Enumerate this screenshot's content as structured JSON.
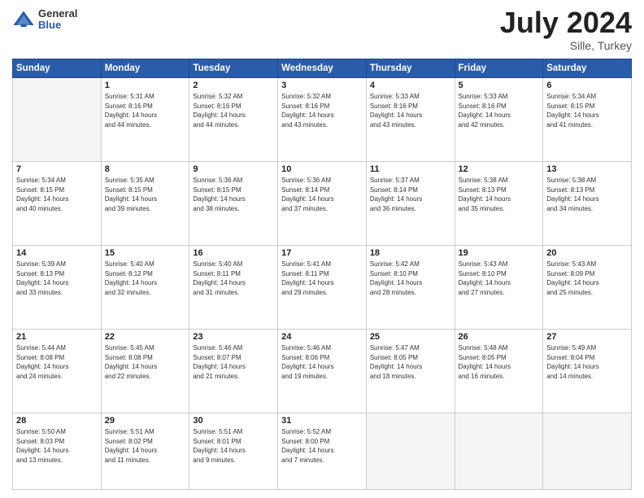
{
  "header": {
    "logo_line1": "General",
    "logo_line2": "Blue",
    "month_year": "July 2024",
    "location": "Sille, Turkey"
  },
  "days_of_week": [
    "Sunday",
    "Monday",
    "Tuesday",
    "Wednesday",
    "Thursday",
    "Friday",
    "Saturday"
  ],
  "weeks": [
    [
      {
        "day": "",
        "info": ""
      },
      {
        "day": "1",
        "info": "Sunrise: 5:31 AM\nSunset: 8:16 PM\nDaylight: 14 hours\nand 44 minutes."
      },
      {
        "day": "2",
        "info": "Sunrise: 5:32 AM\nSunset: 8:16 PM\nDaylight: 14 hours\nand 44 minutes."
      },
      {
        "day": "3",
        "info": "Sunrise: 5:32 AM\nSunset: 8:16 PM\nDaylight: 14 hours\nand 43 minutes."
      },
      {
        "day": "4",
        "info": "Sunrise: 5:33 AM\nSunset: 8:16 PM\nDaylight: 14 hours\nand 43 minutes."
      },
      {
        "day": "5",
        "info": "Sunrise: 5:33 AM\nSunset: 8:16 PM\nDaylight: 14 hours\nand 42 minutes."
      },
      {
        "day": "6",
        "info": "Sunrise: 5:34 AM\nSunset: 8:15 PM\nDaylight: 14 hours\nand 41 minutes."
      }
    ],
    [
      {
        "day": "7",
        "info": "Sunrise: 5:34 AM\nSunset: 8:15 PM\nDaylight: 14 hours\nand 40 minutes."
      },
      {
        "day": "8",
        "info": "Sunrise: 5:35 AM\nSunset: 8:15 PM\nDaylight: 14 hours\nand 39 minutes."
      },
      {
        "day": "9",
        "info": "Sunrise: 5:36 AM\nSunset: 8:15 PM\nDaylight: 14 hours\nand 38 minutes."
      },
      {
        "day": "10",
        "info": "Sunrise: 5:36 AM\nSunset: 8:14 PM\nDaylight: 14 hours\nand 37 minutes."
      },
      {
        "day": "11",
        "info": "Sunrise: 5:37 AM\nSunset: 8:14 PM\nDaylight: 14 hours\nand 36 minutes."
      },
      {
        "day": "12",
        "info": "Sunrise: 5:38 AM\nSunset: 8:13 PM\nDaylight: 14 hours\nand 35 minutes."
      },
      {
        "day": "13",
        "info": "Sunrise: 5:38 AM\nSunset: 8:13 PM\nDaylight: 14 hours\nand 34 minutes."
      }
    ],
    [
      {
        "day": "14",
        "info": "Sunrise: 5:39 AM\nSunset: 8:13 PM\nDaylight: 14 hours\nand 33 minutes."
      },
      {
        "day": "15",
        "info": "Sunrise: 5:40 AM\nSunset: 8:12 PM\nDaylight: 14 hours\nand 32 minutes."
      },
      {
        "day": "16",
        "info": "Sunrise: 5:40 AM\nSunset: 8:11 PM\nDaylight: 14 hours\nand 31 minutes."
      },
      {
        "day": "17",
        "info": "Sunrise: 5:41 AM\nSunset: 8:11 PM\nDaylight: 14 hours\nand 29 minutes."
      },
      {
        "day": "18",
        "info": "Sunrise: 5:42 AM\nSunset: 8:10 PM\nDaylight: 14 hours\nand 28 minutes."
      },
      {
        "day": "19",
        "info": "Sunrise: 5:43 AM\nSunset: 8:10 PM\nDaylight: 14 hours\nand 27 minutes."
      },
      {
        "day": "20",
        "info": "Sunrise: 5:43 AM\nSunset: 8:09 PM\nDaylight: 14 hours\nand 25 minutes."
      }
    ],
    [
      {
        "day": "21",
        "info": "Sunrise: 5:44 AM\nSunset: 8:08 PM\nDaylight: 14 hours\nand 24 minutes."
      },
      {
        "day": "22",
        "info": "Sunrise: 5:45 AM\nSunset: 8:08 PM\nDaylight: 14 hours\nand 22 minutes."
      },
      {
        "day": "23",
        "info": "Sunrise: 5:46 AM\nSunset: 8:07 PM\nDaylight: 14 hours\nand 21 minutes."
      },
      {
        "day": "24",
        "info": "Sunrise: 5:46 AM\nSunset: 8:06 PM\nDaylight: 14 hours\nand 19 minutes."
      },
      {
        "day": "25",
        "info": "Sunrise: 5:47 AM\nSunset: 8:05 PM\nDaylight: 14 hours\nand 18 minutes."
      },
      {
        "day": "26",
        "info": "Sunrise: 5:48 AM\nSunset: 8:05 PM\nDaylight: 14 hours\nand 16 minutes."
      },
      {
        "day": "27",
        "info": "Sunrise: 5:49 AM\nSunset: 8:04 PM\nDaylight: 14 hours\nand 14 minutes."
      }
    ],
    [
      {
        "day": "28",
        "info": "Sunrise: 5:50 AM\nSunset: 8:03 PM\nDaylight: 14 hours\nand 13 minutes."
      },
      {
        "day": "29",
        "info": "Sunrise: 5:51 AM\nSunset: 8:02 PM\nDaylight: 14 hours\nand 11 minutes."
      },
      {
        "day": "30",
        "info": "Sunrise: 5:51 AM\nSunset: 8:01 PM\nDaylight: 14 hours\nand 9 minutes."
      },
      {
        "day": "31",
        "info": "Sunrise: 5:52 AM\nSunset: 8:00 PM\nDaylight: 14 hours\nand 7 minutes."
      },
      {
        "day": "",
        "info": ""
      },
      {
        "day": "",
        "info": ""
      },
      {
        "day": "",
        "info": ""
      }
    ]
  ]
}
